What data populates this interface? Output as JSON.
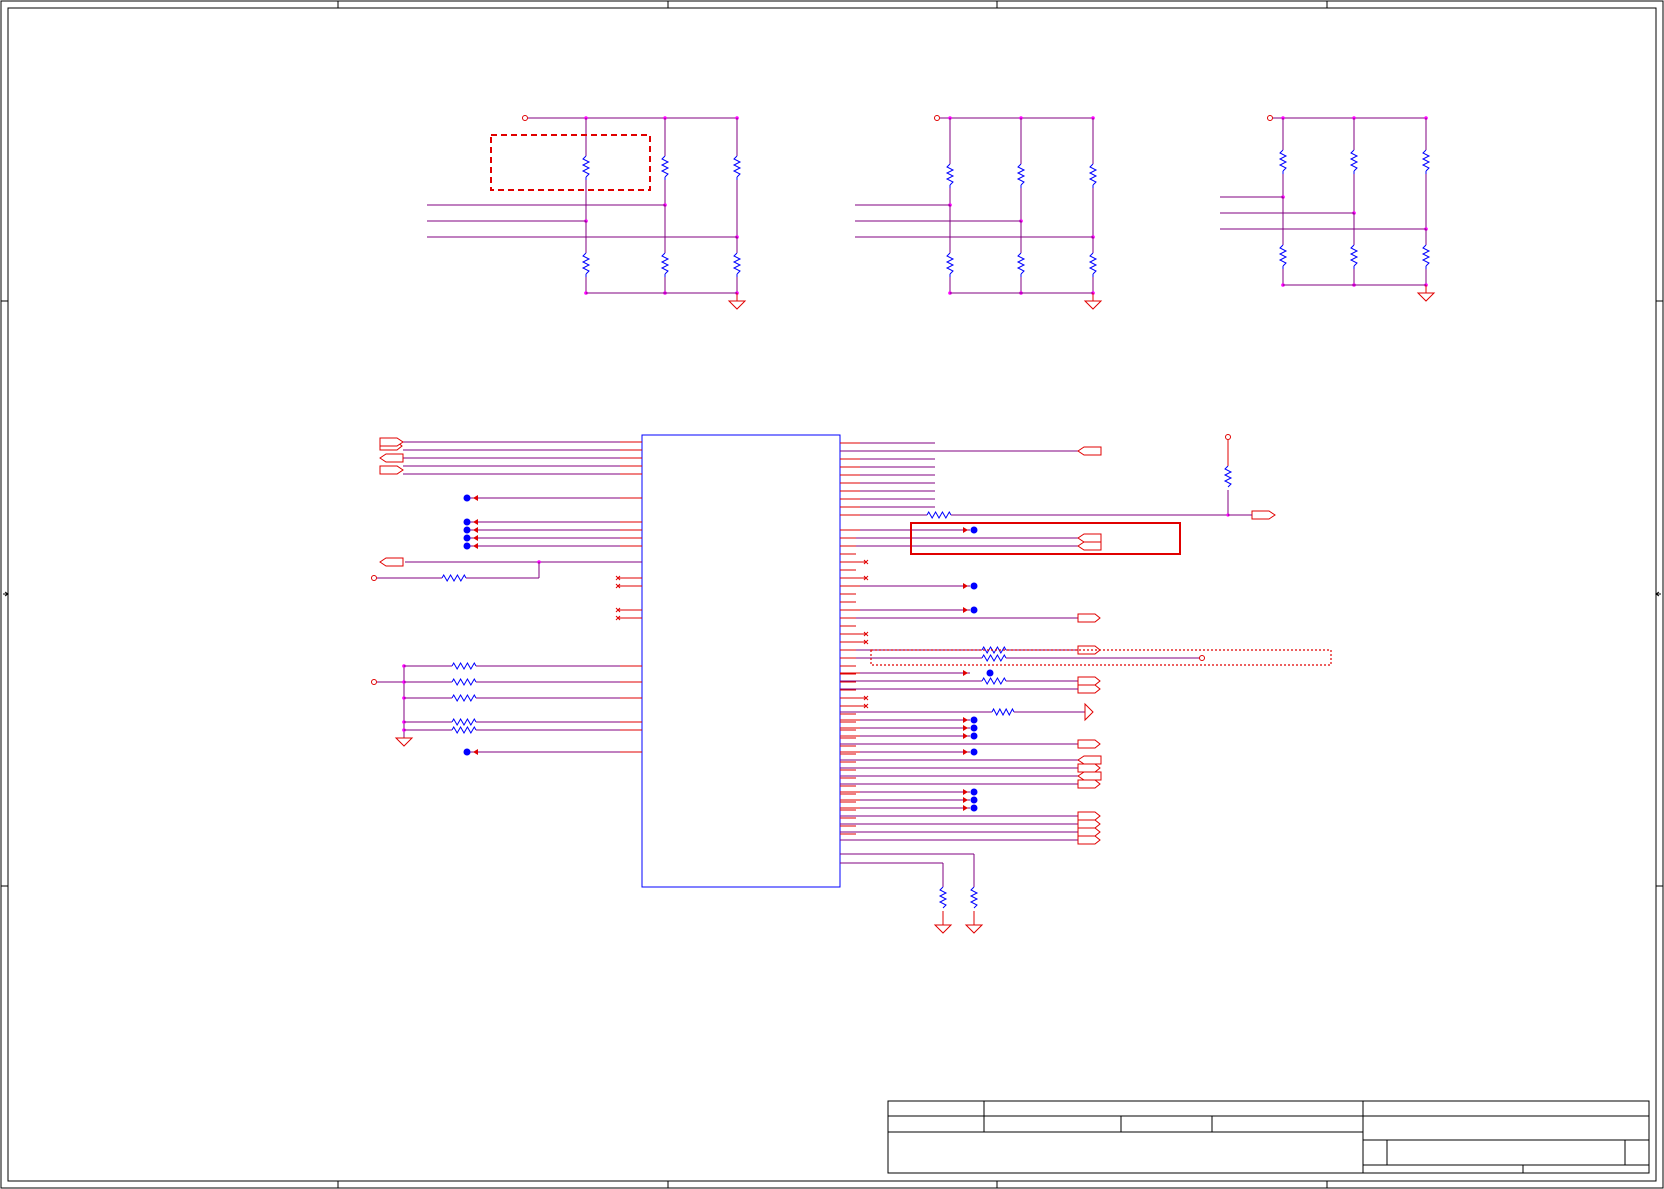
{
  "sheet": {
    "width": 1664,
    "height": 1189
  },
  "colors": {
    "wire": "#800080",
    "signal": "#e00000",
    "component": "#0000ff",
    "junction": "#ff00ff",
    "border": "#000000"
  },
  "labels": {}
}
